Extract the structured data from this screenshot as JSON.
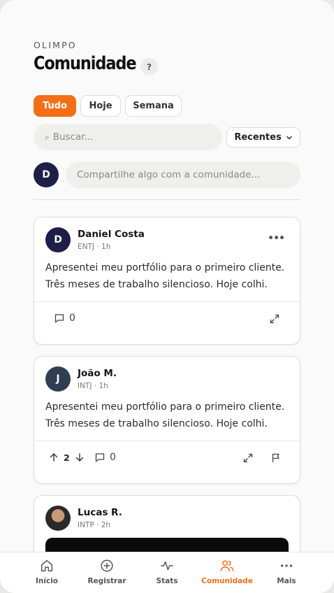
{
  "app": {
    "brand": "OLIMPO",
    "page_title": "Comunidade",
    "help_label": "?"
  },
  "filters": [
    {
      "label": "Tudo",
      "active": true
    },
    {
      "label": "Hoje",
      "active": false
    },
    {
      "label": "Semana",
      "active": false
    }
  ],
  "search": {
    "placeholder": "Buscar..."
  },
  "sort": {
    "label": "Recentes"
  },
  "composer": {
    "avatar_initial": "D",
    "placeholder": "Compartilhe algo com a comunidade..."
  },
  "posts": [
    {
      "initial": "D",
      "author": "Daniel Costa",
      "meta": "ENTJ · 1h",
      "text": "Apresentei meu portfólio para o primeiro cliente. Três meses de trabalho silencioso. Hoje colhi.",
      "comments": "0"
    },
    {
      "initial": "J",
      "author": "João M.",
      "meta": "INTJ · 1h",
      "text": "Apresentei meu portfólio para o primeiro cliente. Três meses de trabalho silencioso. Hoje colhi.",
      "votes": "2",
      "comments": "0"
    },
    {
      "author": "Lucas R.",
      "meta": "INTP · 2h"
    }
  ],
  "nav": [
    {
      "label": "Início",
      "icon": "home-icon",
      "active": false
    },
    {
      "label": "Registrar",
      "icon": "plus-circle-icon",
      "active": false
    },
    {
      "label": "Stats",
      "icon": "activity-icon",
      "active": false
    },
    {
      "label": "Comunidade",
      "icon": "users-icon",
      "active": true
    },
    {
      "label": "Mais",
      "icon": "more-dots-icon",
      "active": false
    }
  ],
  "colors": {
    "accent": "#f36f17",
    "avatar_navy": "#1d1f47",
    "avatar_slate": "#2f3e51"
  }
}
